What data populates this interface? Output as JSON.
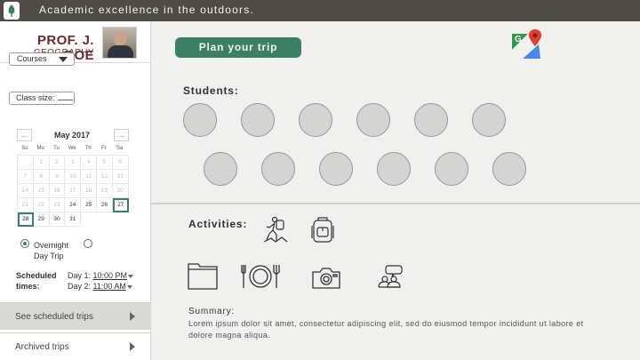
{
  "header": {
    "tagline": "Academic excellence in the outdoors."
  },
  "profile": {
    "name": "PROF. J. DOE",
    "department": "GEOGRAPHY"
  },
  "filters": {
    "courses_label": "Courses",
    "class_size_label": "Class size:"
  },
  "calendar": {
    "prev": "←",
    "next": "→",
    "title": "May 2017",
    "dow": [
      "Su",
      "Mo",
      "Tu",
      "We",
      "Th",
      "Fr",
      "Sa"
    ],
    "days": [
      {
        "d": "",
        "s": "blank"
      },
      {
        "d": "1",
        "s": "muted"
      },
      {
        "d": "2",
        "s": "muted"
      },
      {
        "d": "3",
        "s": "muted"
      },
      {
        "d": "4",
        "s": "muted"
      },
      {
        "d": "5",
        "s": "muted"
      },
      {
        "d": "6",
        "s": "muted"
      },
      {
        "d": "7",
        "s": "muted"
      },
      {
        "d": "8",
        "s": "muted"
      },
      {
        "d": "9",
        "s": "muted"
      },
      {
        "d": "10",
        "s": "muted"
      },
      {
        "d": "11",
        "s": "muted"
      },
      {
        "d": "12",
        "s": "muted"
      },
      {
        "d": "13",
        "s": "muted"
      },
      {
        "d": "14",
        "s": "muted"
      },
      {
        "d": "15",
        "s": "muted"
      },
      {
        "d": "16",
        "s": "muted"
      },
      {
        "d": "17",
        "s": "muted"
      },
      {
        "d": "18",
        "s": "muted"
      },
      {
        "d": "19",
        "s": "muted"
      },
      {
        "d": "20",
        "s": "muted"
      },
      {
        "d": "21",
        "s": "muted"
      },
      {
        "d": "22",
        "s": "muted"
      },
      {
        "d": "23",
        "s": "muted"
      },
      {
        "d": "24",
        "s": "avail"
      },
      {
        "d": "25",
        "s": "avail"
      },
      {
        "d": "26",
        "s": "avail"
      },
      {
        "d": "27",
        "s": "sel"
      },
      {
        "d": "28",
        "s": "sel"
      },
      {
        "d": "29",
        "s": "avail"
      },
      {
        "d": "30",
        "s": "avail"
      },
      {
        "d": "31",
        "s": "avail"
      }
    ]
  },
  "trip_type": {
    "overnight": "Overnight",
    "day_trip": "Day Trip",
    "selected": "overnight"
  },
  "schedule": {
    "label_line1": "Scheduled",
    "label_line2": "times:",
    "day1_label": "Day 1:",
    "day1_time": "10:00 PM",
    "day2_label": "Day 2:",
    "day2_time": "11:00 AM"
  },
  "nav": {
    "scheduled": "See scheduled trips",
    "archived": "Archived trips"
  },
  "main": {
    "plan_button": "Plan your trip",
    "students_label": "Students:",
    "activities_label": "Activities:",
    "summary_label": "Summary:",
    "summary_text": "Lorem ipsum dolor sit amet, consectetur adipiscing elit, sed do eiusmod tempor incididunt ut labore et dolore magna aliqua."
  },
  "icons": {
    "logo": "tree-logo-icon",
    "maps": "google-maps-icon",
    "activities": [
      "hiker-icon",
      "backpack-icon",
      "folder-icon",
      "dining-icon",
      "camera-icon",
      "group-chat-icon"
    ]
  },
  "colors": {
    "accent": "#3c7f67",
    "topbar": "#4e4c45",
    "name": "#6b2b2b"
  }
}
